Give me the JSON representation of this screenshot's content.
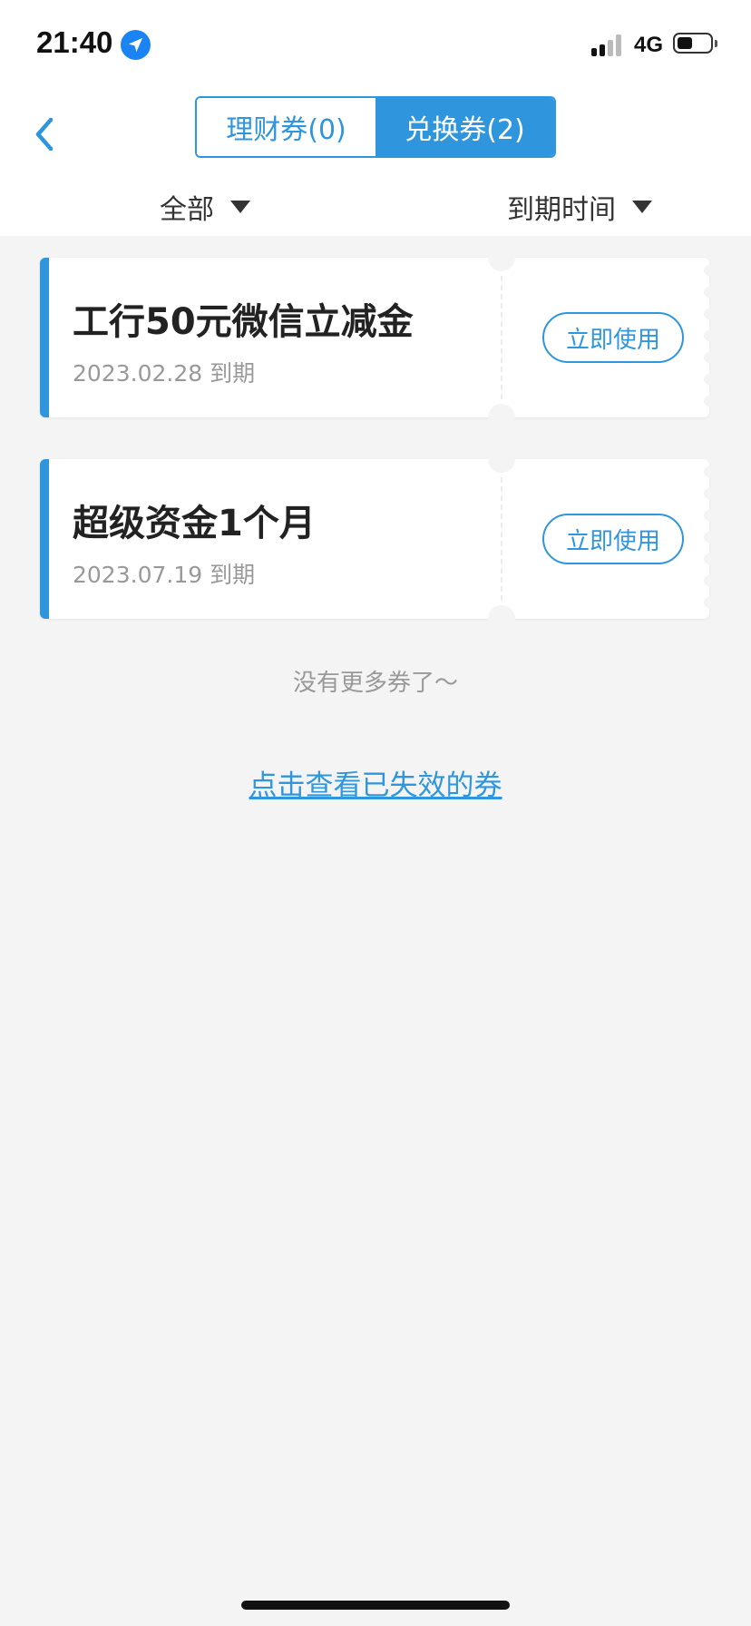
{
  "status_bar": {
    "time": "21:40",
    "location_icon": "location-arrow-icon",
    "network": "4G",
    "battery_level": 0.45
  },
  "header": {
    "back_icon": "chevron-left-icon",
    "tabs": [
      {
        "label": "理财券(0)",
        "active": false
      },
      {
        "label": "兑换券(2)",
        "active": true
      }
    ]
  },
  "filters": {
    "category": "全部",
    "sort": "到期时间"
  },
  "coupons": [
    {
      "title": "工行50元微信立减金",
      "expire": "2023.02.28 到期",
      "button": "立即使用"
    },
    {
      "title": "超级资金1个月",
      "expire": "2023.07.19 到期",
      "button": "立即使用"
    }
  ],
  "footer": {
    "no_more": "没有更多券了～",
    "expired_link": "点击查看已失效的券"
  },
  "colors": {
    "accent": "#2f96de",
    "background": "#f4f4f4"
  }
}
